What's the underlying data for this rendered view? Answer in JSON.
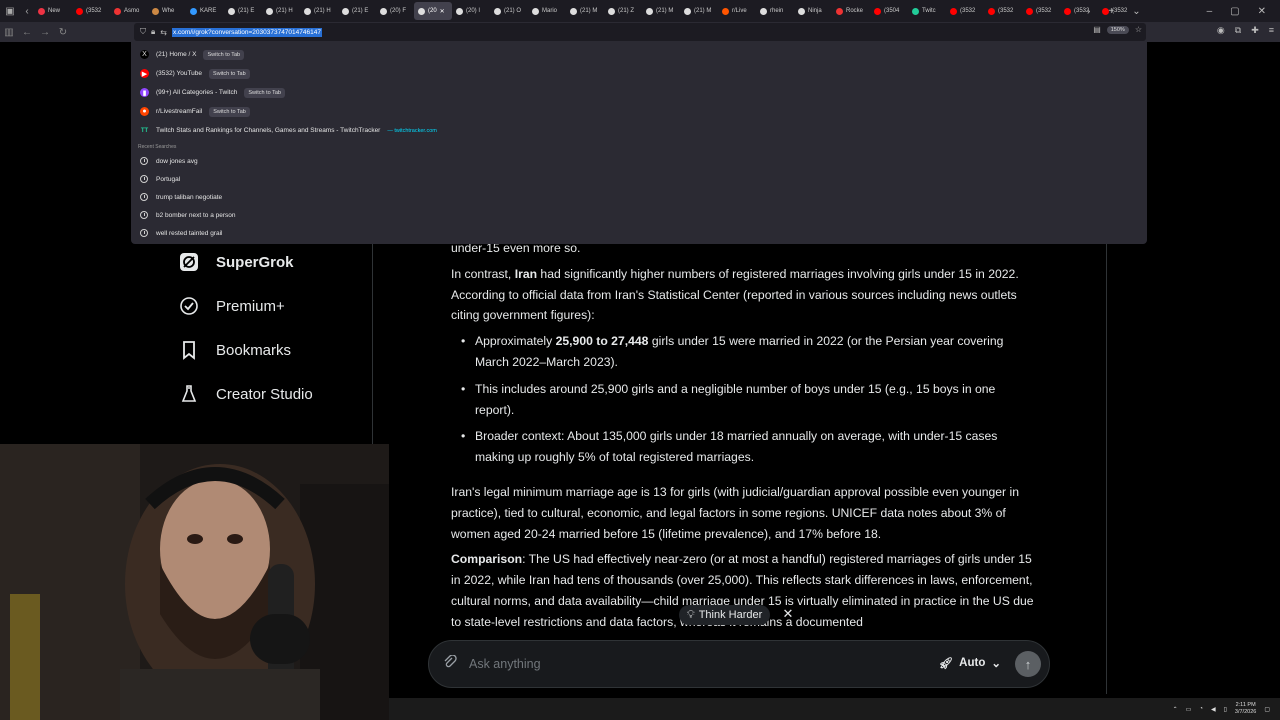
{
  "browser": {
    "tabs": [
      {
        "label": "New",
        "color": "#e34"
      },
      {
        "label": "(3532",
        "color": "#f00"
      },
      {
        "label": "Asmo",
        "color": "#e33"
      },
      {
        "label": "Whe",
        "color": "#c84"
      },
      {
        "label": "KARE",
        "color": "#39f"
      },
      {
        "label": "(21) E",
        "color": "#ddd"
      },
      {
        "label": "(21) H",
        "color": "#ddd"
      },
      {
        "label": "(21) H",
        "color": "#ddd"
      },
      {
        "label": "(21) E",
        "color": "#ddd"
      },
      {
        "label": "(20) F",
        "color": "#ddd"
      },
      {
        "label": "(20",
        "color": "#ddd",
        "active": true
      },
      {
        "label": "(20) I",
        "color": "#ddd"
      },
      {
        "label": "(21) O",
        "color": "#ddd"
      },
      {
        "label": "Mario",
        "color": "#ddd"
      },
      {
        "label": "(21) M",
        "color": "#ddd"
      },
      {
        "label": "(21) Z",
        "color": "#ddd"
      },
      {
        "label": "(21) M",
        "color": "#ddd"
      },
      {
        "label": "(21) M",
        "color": "#ddd"
      },
      {
        "label": "r/Live",
        "color": "#f50"
      },
      {
        "label": "rhein",
        "color": "#ddd"
      },
      {
        "label": "Ninja",
        "color": "#ddd"
      },
      {
        "label": "Rocke",
        "color": "#e33"
      },
      {
        "label": "(3504",
        "color": "#f00"
      },
      {
        "label": "Twitc",
        "color": "#2c9"
      },
      {
        "label": "(3532",
        "color": "#f00"
      },
      {
        "label": "(3532",
        "color": "#f00"
      },
      {
        "label": "(3532",
        "color": "#f00"
      },
      {
        "label": "(3532",
        "color": "#f00"
      },
      {
        "label": "(3532",
        "color": "#f00"
      }
    ],
    "url": "x.com/i/grok?conversation=2030373747014746147",
    "zoom": "150%"
  },
  "dropdown": {
    "suggestions": [
      {
        "icon": "X",
        "icon_color": "#ddd",
        "icon_bg": "#000",
        "title": "(21) Home / X",
        "action": "Switch to Tab"
      },
      {
        "icon": "▶",
        "icon_color": "#fff",
        "icon_bg": "#f00",
        "title": "(3532) YouTube",
        "action": "Switch to Tab"
      },
      {
        "icon": "▮",
        "icon_color": "#fff",
        "icon_bg": "#9146ff",
        "title": "(99+) All Categories - Twitch",
        "action": "Switch to Tab"
      },
      {
        "icon": "●",
        "icon_color": "#fff",
        "icon_bg": "#ff4500",
        "title": "r/LivestreamFail",
        "action": "Switch to Tab"
      }
    ],
    "tracker": {
      "icon": "TT",
      "title": "Twitch Stats and Rankings for Channels, Games and Streams - TwitchTracker",
      "url": "— twitchtracker.com"
    },
    "recent_heading": "Recent Searches",
    "recent": [
      "dow jones avg",
      "Portugal",
      "trump taliban negotiate",
      "b2 bomber next to a person",
      "well rested tainted grail"
    ]
  },
  "sidebar": {
    "items": [
      {
        "label": "SuperGrok",
        "bold": true
      },
      {
        "label": "Premium+"
      },
      {
        "label": "Bookmarks"
      },
      {
        "label": "Creator Studio"
      }
    ]
  },
  "article": {
    "p0": "under-15 even more so.",
    "p1a": "In contrast, ",
    "p1b": "Iran",
    "p1c": " had significantly higher numbers of registered marriages involving girls under 15 in 2022. According to official data from Iran's Statistical Center (reported in various sources including news outlets citing government figures):",
    "b1a": "Approximately ",
    "b1b": "25,900 to 27,448",
    "b1c": " girls under 15 were married in 2022 (or the Persian year covering March 2022–March 2023).",
    "b2": "This includes around 25,900 girls and a negligible number of boys under 15 (e.g., 15 boys in one report).",
    "b3": "Broader context: About 135,000 girls under 18 married annually on average, with under-15 cases making up roughly 5% of total registered marriages.",
    "p2": "Iran's legal minimum marriage age is 13 for girls (with judicial/guardian approval possible even younger in practice), tied to cultural, economic, and legal factors in some regions. UNICEF data notes about 3% of women aged 20-24 married before 15 (lifetime prevalence), and 17% before 18.",
    "p3a": "Comparison",
    "p3b": ": The US had effectively near-zero (or at most a handful) registered marriages of girls under 15 in 2022, while Iran had tens of thousands (over 25,000). This reflects stark differences in laws, enforcement, cultural norms, and data availability—child marriage under 15 is virtually eliminated in practice in the US due to state-level restrictions and data factors, whereas it remains a documented"
  },
  "composer": {
    "think_label": "Think Harder",
    "placeholder": "Ask anything",
    "mode": "Auto"
  },
  "taskbar": {
    "time": "2:11 PM",
    "date": "3/7/2026"
  }
}
